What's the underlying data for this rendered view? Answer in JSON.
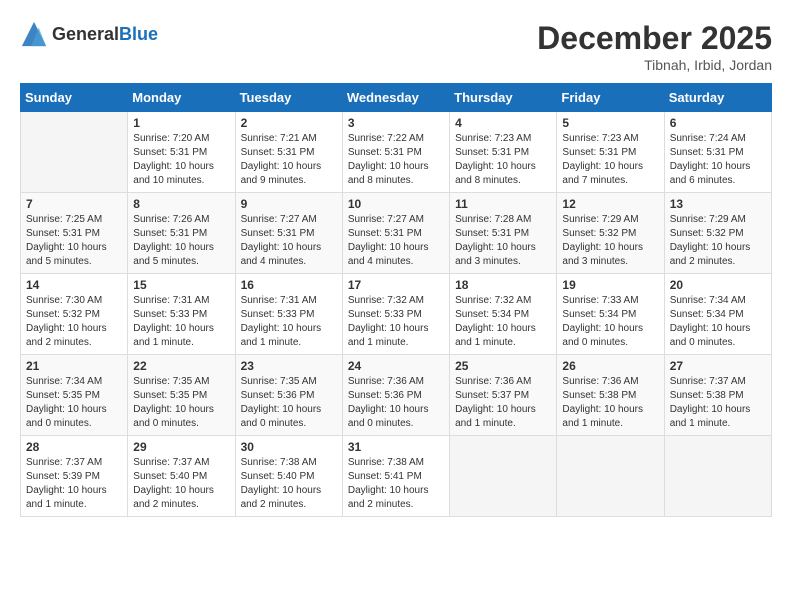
{
  "header": {
    "logo_general": "General",
    "logo_blue": "Blue",
    "month": "December 2025",
    "location": "Tibnah, Irbid, Jordan"
  },
  "days_of_week": [
    "Sunday",
    "Monday",
    "Tuesday",
    "Wednesday",
    "Thursday",
    "Friday",
    "Saturday"
  ],
  "weeks": [
    [
      {
        "day": "",
        "info": ""
      },
      {
        "day": "1",
        "info": "Sunrise: 7:20 AM\nSunset: 5:31 PM\nDaylight: 10 hours\nand 10 minutes."
      },
      {
        "day": "2",
        "info": "Sunrise: 7:21 AM\nSunset: 5:31 PM\nDaylight: 10 hours\nand 9 minutes."
      },
      {
        "day": "3",
        "info": "Sunrise: 7:22 AM\nSunset: 5:31 PM\nDaylight: 10 hours\nand 8 minutes."
      },
      {
        "day": "4",
        "info": "Sunrise: 7:23 AM\nSunset: 5:31 PM\nDaylight: 10 hours\nand 8 minutes."
      },
      {
        "day": "5",
        "info": "Sunrise: 7:23 AM\nSunset: 5:31 PM\nDaylight: 10 hours\nand 7 minutes."
      },
      {
        "day": "6",
        "info": "Sunrise: 7:24 AM\nSunset: 5:31 PM\nDaylight: 10 hours\nand 6 minutes."
      }
    ],
    [
      {
        "day": "7",
        "info": "Sunrise: 7:25 AM\nSunset: 5:31 PM\nDaylight: 10 hours\nand 5 minutes."
      },
      {
        "day": "8",
        "info": "Sunrise: 7:26 AM\nSunset: 5:31 PM\nDaylight: 10 hours\nand 5 minutes."
      },
      {
        "day": "9",
        "info": "Sunrise: 7:27 AM\nSunset: 5:31 PM\nDaylight: 10 hours\nand 4 minutes."
      },
      {
        "day": "10",
        "info": "Sunrise: 7:27 AM\nSunset: 5:31 PM\nDaylight: 10 hours\nand 4 minutes."
      },
      {
        "day": "11",
        "info": "Sunrise: 7:28 AM\nSunset: 5:31 PM\nDaylight: 10 hours\nand 3 minutes."
      },
      {
        "day": "12",
        "info": "Sunrise: 7:29 AM\nSunset: 5:32 PM\nDaylight: 10 hours\nand 3 minutes."
      },
      {
        "day": "13",
        "info": "Sunrise: 7:29 AM\nSunset: 5:32 PM\nDaylight: 10 hours\nand 2 minutes."
      }
    ],
    [
      {
        "day": "14",
        "info": "Sunrise: 7:30 AM\nSunset: 5:32 PM\nDaylight: 10 hours\nand 2 minutes."
      },
      {
        "day": "15",
        "info": "Sunrise: 7:31 AM\nSunset: 5:33 PM\nDaylight: 10 hours\nand 1 minute."
      },
      {
        "day": "16",
        "info": "Sunrise: 7:31 AM\nSunset: 5:33 PM\nDaylight: 10 hours\nand 1 minute."
      },
      {
        "day": "17",
        "info": "Sunrise: 7:32 AM\nSunset: 5:33 PM\nDaylight: 10 hours\nand 1 minute."
      },
      {
        "day": "18",
        "info": "Sunrise: 7:32 AM\nSunset: 5:34 PM\nDaylight: 10 hours\nand 1 minute."
      },
      {
        "day": "19",
        "info": "Sunrise: 7:33 AM\nSunset: 5:34 PM\nDaylight: 10 hours\nand 0 minutes."
      },
      {
        "day": "20",
        "info": "Sunrise: 7:34 AM\nSunset: 5:34 PM\nDaylight: 10 hours\nand 0 minutes."
      }
    ],
    [
      {
        "day": "21",
        "info": "Sunrise: 7:34 AM\nSunset: 5:35 PM\nDaylight: 10 hours\nand 0 minutes."
      },
      {
        "day": "22",
        "info": "Sunrise: 7:35 AM\nSunset: 5:35 PM\nDaylight: 10 hours\nand 0 minutes."
      },
      {
        "day": "23",
        "info": "Sunrise: 7:35 AM\nSunset: 5:36 PM\nDaylight: 10 hours\nand 0 minutes."
      },
      {
        "day": "24",
        "info": "Sunrise: 7:36 AM\nSunset: 5:36 PM\nDaylight: 10 hours\nand 0 minutes."
      },
      {
        "day": "25",
        "info": "Sunrise: 7:36 AM\nSunset: 5:37 PM\nDaylight: 10 hours\nand 1 minute."
      },
      {
        "day": "26",
        "info": "Sunrise: 7:36 AM\nSunset: 5:38 PM\nDaylight: 10 hours\nand 1 minute."
      },
      {
        "day": "27",
        "info": "Sunrise: 7:37 AM\nSunset: 5:38 PM\nDaylight: 10 hours\nand 1 minute."
      }
    ],
    [
      {
        "day": "28",
        "info": "Sunrise: 7:37 AM\nSunset: 5:39 PM\nDaylight: 10 hours\nand 1 minute."
      },
      {
        "day": "29",
        "info": "Sunrise: 7:37 AM\nSunset: 5:40 PM\nDaylight: 10 hours\nand 2 minutes."
      },
      {
        "day": "30",
        "info": "Sunrise: 7:38 AM\nSunset: 5:40 PM\nDaylight: 10 hours\nand 2 minutes."
      },
      {
        "day": "31",
        "info": "Sunrise: 7:38 AM\nSunset: 5:41 PM\nDaylight: 10 hours\nand 2 minutes."
      },
      {
        "day": "",
        "info": ""
      },
      {
        "day": "",
        "info": ""
      },
      {
        "day": "",
        "info": ""
      }
    ]
  ]
}
